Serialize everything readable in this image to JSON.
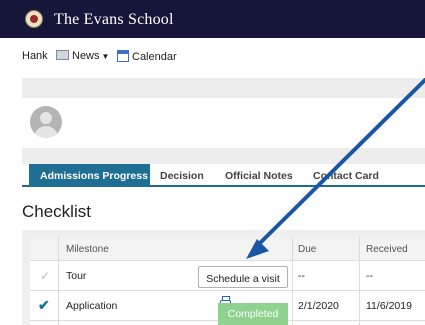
{
  "header": {
    "school_name": "The Evans School"
  },
  "nav": {
    "user": "Hank",
    "news_label": "News",
    "calendar_label": "Calendar"
  },
  "tabs": [
    {
      "label": "Admissions Progress",
      "active": true
    },
    {
      "label": "Decision",
      "active": false
    },
    {
      "label": "Official Notes",
      "active": false
    },
    {
      "label": "Contact Card",
      "active": false
    }
  ],
  "checklist": {
    "title": "Checklist",
    "columns": {
      "milestone": "Milestone",
      "due": "Due",
      "received": "Received"
    },
    "rows": [
      {
        "milestone": "Tour",
        "due": "--",
        "received": "--",
        "action": "Schedule a visit",
        "done": false
      },
      {
        "milestone": "Application",
        "due": "2/1/2020",
        "received": "11/6/2019",
        "status": "Completed",
        "done": true
      }
    ]
  },
  "colors": {
    "header_bg": "#15163a",
    "active_tab": "#1f6e93",
    "completed_green": "#8fd18f",
    "arrow": "#1c56a3"
  }
}
